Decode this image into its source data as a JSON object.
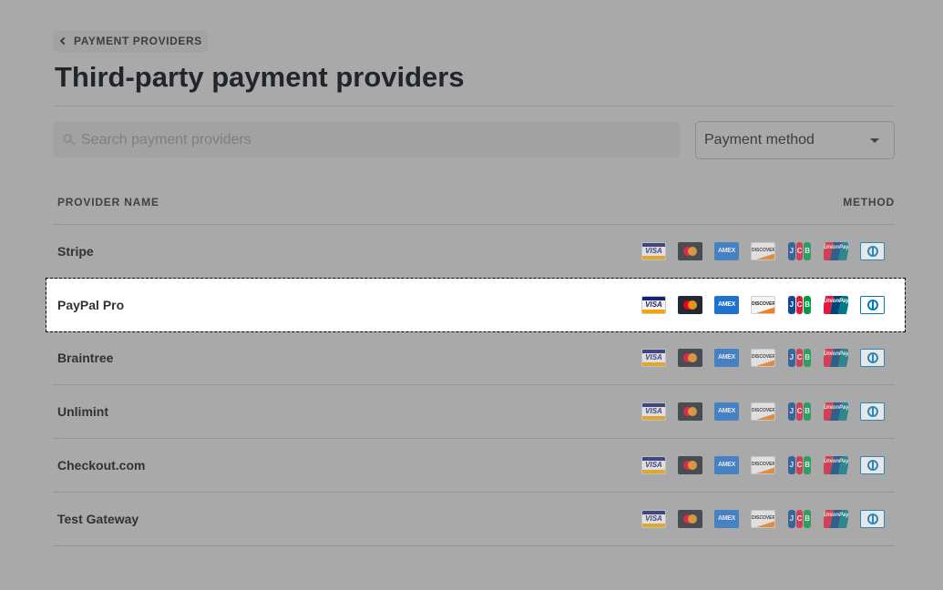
{
  "breadcrumb": {
    "label": "PAYMENT PROVIDERS",
    "icon": "chevron-left-icon"
  },
  "page_title": "Third-party payment providers",
  "search": {
    "placeholder": "Search payment providers",
    "value": "",
    "icon": "search-icon"
  },
  "filter": {
    "selected": "Payment method",
    "icon": "caret-down-icon"
  },
  "table": {
    "columns": {
      "name": "PROVIDER NAME",
      "method": "METHOD"
    },
    "card_labels": {
      "visa": "VISA",
      "amex": "AMEX",
      "discover": "DISCOVER",
      "jcb": [
        "J",
        "C",
        "B"
      ],
      "unionpay": "UnionPay"
    },
    "rows": [
      {
        "name": "Stripe",
        "selected": false
      },
      {
        "name": "PayPal Pro",
        "selected": true
      },
      {
        "name": "Braintree",
        "selected": false
      },
      {
        "name": "Unlimint",
        "selected": false
      },
      {
        "name": "Checkout.com",
        "selected": false
      },
      {
        "name": "Test Gateway",
        "selected": false
      }
    ],
    "methods": [
      "visa-icon",
      "mastercard-icon",
      "amex-icon",
      "discover-icon",
      "jcb-icon",
      "unionpay-icon",
      "diners-club-icon"
    ]
  },
  "colors": {
    "overlay": "#a9a9a9",
    "selected_row": "#ffffff",
    "text": "#2b2e33"
  }
}
